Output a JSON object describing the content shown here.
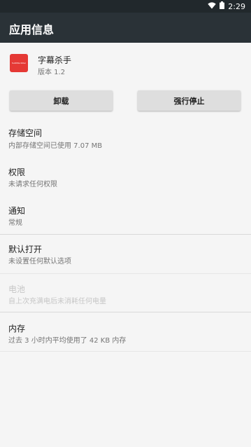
{
  "status_bar": {
    "time": "2:29",
    "icons": [
      "wifi-icon",
      "battery-icon"
    ]
  },
  "toolbar": {
    "title": "应用信息"
  },
  "app": {
    "name": "字幕杀手",
    "version": "版本 1.2",
    "icon_text": "Subtitle Killer"
  },
  "buttons": {
    "uninstall": "卸载",
    "force_stop": "强行停止"
  },
  "prefs": [
    {
      "title": "存储空间",
      "summary": "内部存储空间已使用 7.07 MB",
      "enabled": true
    },
    {
      "title": "权限",
      "summary": "未请求任何权限",
      "enabled": true
    },
    {
      "title": "通知",
      "summary": "常规",
      "enabled": true
    },
    {
      "title": "默认打开",
      "summary": "未设置任何默认选项",
      "enabled": true
    },
    {
      "title": "电池",
      "summary": "自上次充满电后未消耗任何电量",
      "enabled": false
    },
    {
      "title": "内存",
      "summary": "过去 3 小时内平均使用了 42 KB 内存",
      "enabled": true
    }
  ],
  "colors": {
    "status_bar": "#21282c",
    "toolbar": "#2a3237",
    "app_icon": "#e53935",
    "background": "#f5f5f5",
    "button": "#dedede"
  }
}
